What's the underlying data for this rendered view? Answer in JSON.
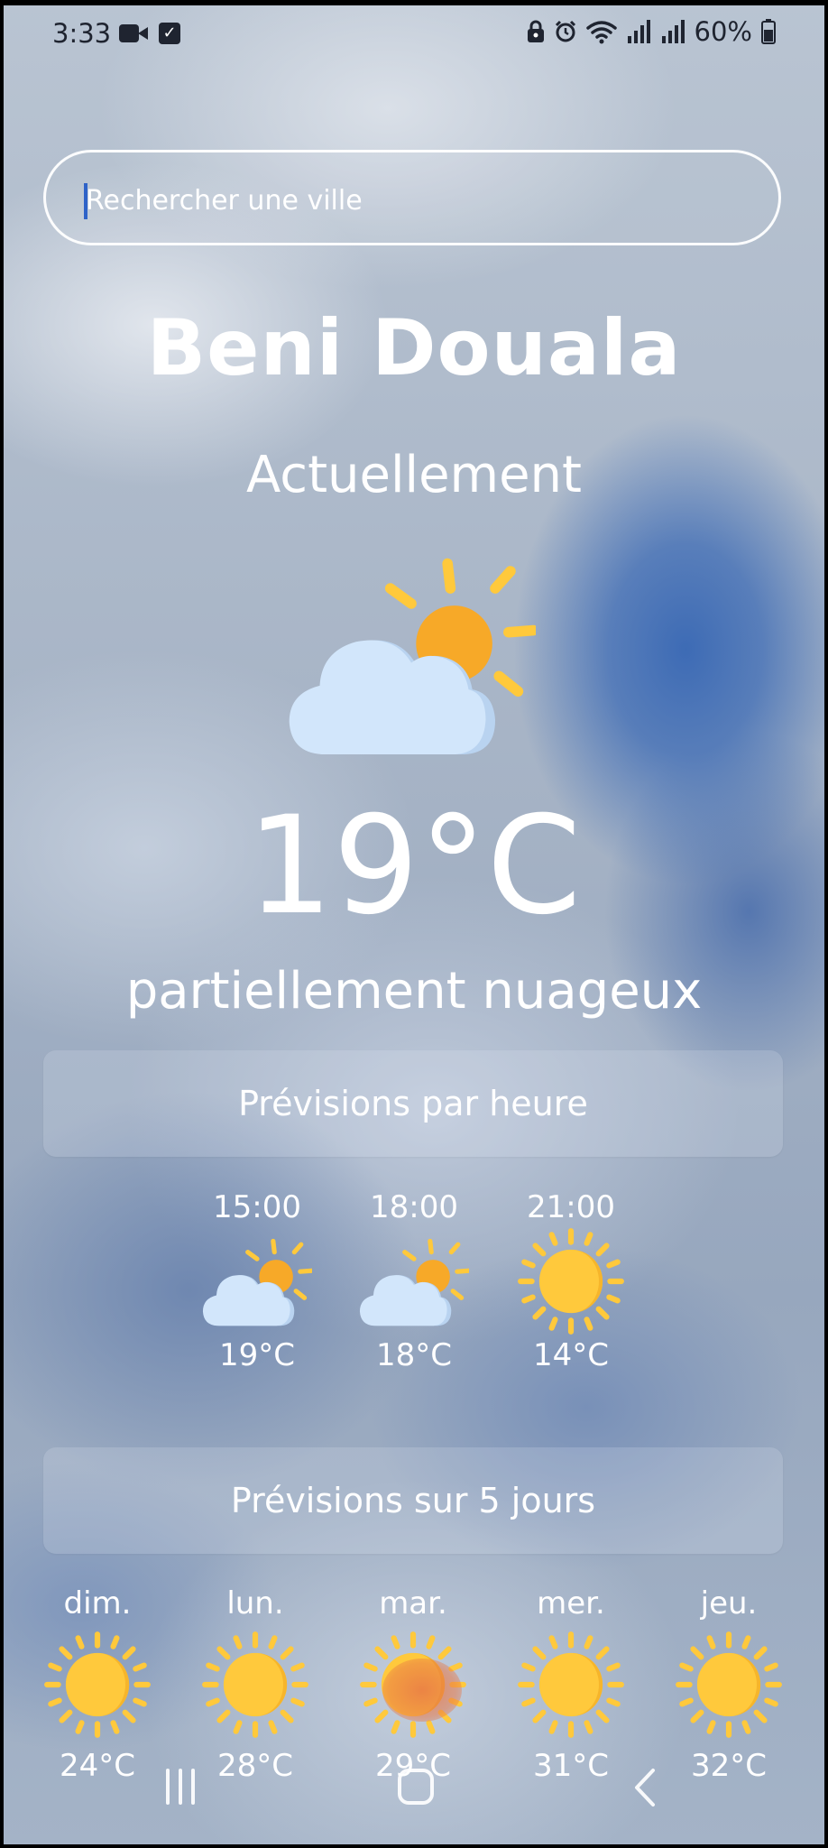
{
  "status_bar": {
    "time": "3:33",
    "battery": "60%"
  },
  "search": {
    "placeholder": "Rechercher une ville"
  },
  "current": {
    "city": "Beni Douala",
    "label": "Actuellement",
    "temperature": "19°C",
    "condition": "partiellement nuageux",
    "icon": "partly-cloudy-icon"
  },
  "hourly": {
    "title": "Prévisions par heure",
    "items": [
      {
        "time": "15:00",
        "temp": "19°C",
        "icon": "partly-cloudy-icon"
      },
      {
        "time": "18:00",
        "temp": "18°C",
        "icon": "partly-cloudy-icon"
      },
      {
        "time": "21:00",
        "temp": "14°C",
        "icon": "sun-icon"
      }
    ]
  },
  "daily": {
    "title": "Prévisions sur 5 jours",
    "items": [
      {
        "day": "dim.",
        "temp": "24°C",
        "icon": "sun-icon"
      },
      {
        "day": "lun.",
        "temp": "28°C",
        "icon": "sun-icon"
      },
      {
        "day": "mar.",
        "temp": "29°C",
        "icon": "sun-icon"
      },
      {
        "day": "mer.",
        "temp": "31°C",
        "icon": "sun-icon"
      },
      {
        "day": "jeu.",
        "temp": "32°C",
        "icon": "sun-icon"
      }
    ]
  },
  "colors": {
    "sun": "#FFC93C",
    "sun_dark": "#F6A924",
    "cloud": "#D2E6FB",
    "cloud_shadow": "#B9D3F0",
    "caret": "#2F63C8"
  }
}
